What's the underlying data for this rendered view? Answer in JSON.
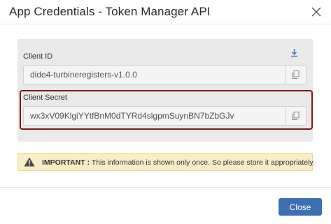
{
  "dialog": {
    "title": "App Credentials - Token Manager API"
  },
  "client_id": {
    "label": "Client ID",
    "value": "dide4-turbineregisters-v1.0.0"
  },
  "client_secret": {
    "label": "Client Secret",
    "value": "wx3xV09KlgiYYtfBnM0dTYRd4slgpmSuynBN7bZbGJv"
  },
  "notice": {
    "strong": "IMPORTANT :",
    "text": " This information is shown only once. So please store it appropriately."
  },
  "footer": {
    "close_label": "Close"
  },
  "colors": {
    "accent": "#3d6fb3",
    "highlight_border": "#7a1818",
    "warning_bg": "#f8edc7"
  }
}
